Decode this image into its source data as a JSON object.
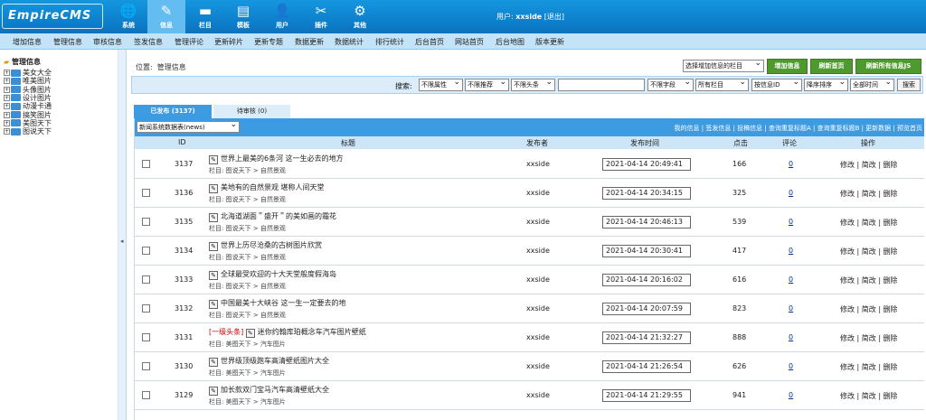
{
  "app": {
    "logo": "EmpireCMS"
  },
  "topnav": [
    {
      "label": "系统",
      "icon": "globe-icon",
      "glyph": "🌐"
    },
    {
      "label": "信息",
      "icon": "edit-icon",
      "glyph": "✎"
    },
    {
      "label": "栏目",
      "icon": "folder-icon",
      "glyph": "▬"
    },
    {
      "label": "模板",
      "icon": "template-icon",
      "glyph": "▤"
    },
    {
      "label": "用户",
      "icon": "user-icon",
      "glyph": "👤"
    },
    {
      "label": "插件",
      "icon": "tools-icon",
      "glyph": "✂"
    },
    {
      "label": "其他",
      "icon": "gear-icon",
      "glyph": "⚙"
    }
  ],
  "user": {
    "prefix": "用户:",
    "name": "xxside",
    "logout": "[退出]"
  },
  "subnav": [
    "增加信息",
    "管理信息",
    "审核信息",
    "签发信息",
    "管理评论",
    "更新碎片",
    "更新专题",
    "数据更新",
    "数据统计",
    "排行统计",
    "后台首页",
    "网站首页",
    "后台地图",
    "版本更新"
  ],
  "sidebar": {
    "title": "管理信息",
    "items": [
      "美女大全",
      "唯美图片",
      "头像图片",
      "设计图片",
      "动漫卡通",
      "搞笑图片",
      "美图天下",
      "图说天下"
    ]
  },
  "position": {
    "label": "位置:",
    "value": "管理信息"
  },
  "top_controls": {
    "column_select": "选择增加信息的栏目",
    "add_info": "增加信息",
    "refresh_home": "刷新首页",
    "refresh_all": "刷新所有信息JS"
  },
  "search": {
    "label": "搜索:",
    "attr": "不限属性",
    "recommend": "不限推荐",
    "headline": "不限头条",
    "keyword": "",
    "field": "不限字段",
    "column": "所有栏目",
    "order_by": "按信息ID",
    "order_dir": "降序排序",
    "time": "全部时间",
    "button": "搜索"
  },
  "tabs": {
    "published": "已发布 (3137)",
    "pending": "待审核 (0)"
  },
  "table": {
    "table_select": "新闻系统数据表(news)",
    "links": "我的信息 | 签发信息 | 投稿信息 | 查询重复标题A | 查询重复标题B | 更新数据 | 预览首页",
    "headers": {
      "id": "ID",
      "title": "标题",
      "publisher": "发布者",
      "time": "发布时间",
      "hits": "点击",
      "comments": "评论",
      "ops": "操作"
    },
    "op_labels": {
      "edit": "修改",
      "simple": "简改",
      "delete": "删除"
    },
    "rows": [
      {
        "id": "3137",
        "tag": "",
        "title": "世界上最美的6条河 这一生必去的地方",
        "cat": "栏目: 图说天下 > 自然景观",
        "publisher": "xxside",
        "time": "2021-04-14 20:49:41",
        "hits": "166",
        "comments": "0"
      },
      {
        "id": "3136",
        "tag": "",
        "title": "美地有的自然景观 堪称人间天堂",
        "cat": "栏目: 图说天下 > 自然景观",
        "publisher": "xxside",
        "time": "2021-04-14 20:34:15",
        "hits": "325",
        "comments": "0"
      },
      {
        "id": "3135",
        "tag": "",
        "title": "北海道湖面＂盛开＂的美如画的霜花",
        "cat": "栏目: 图说天下 > 自然景观",
        "publisher": "xxside",
        "time": "2021-04-14 20:46:13",
        "hits": "539",
        "comments": "0"
      },
      {
        "id": "3134",
        "tag": "",
        "title": "世界上历尽沧桑的古树图片欣赏",
        "cat": "栏目: 图说天下 > 自然景观",
        "publisher": "xxside",
        "time": "2021-04-14 20:30:41",
        "hits": "417",
        "comments": "0"
      },
      {
        "id": "3133",
        "tag": "",
        "title": "全球最受欢迎的十大天堂般度假海岛",
        "cat": "栏目: 图说天下 > 自然景观",
        "publisher": "xxside",
        "time": "2021-04-14 20:16:02",
        "hits": "616",
        "comments": "0"
      },
      {
        "id": "3132",
        "tag": "",
        "title": "中国最美十大峡谷 这一生一定要去的地",
        "cat": "栏目: 图说天下 > 自然景观",
        "publisher": "xxside",
        "time": "2021-04-14 20:07:59",
        "hits": "823",
        "comments": "0"
      },
      {
        "id": "3131",
        "tag": "[一级头条]",
        "title": "迷你约翰库珀概念车汽车图片壁纸",
        "cat": "栏目: 美图天下 > 汽车图片",
        "publisher": "xxside",
        "time": "2021-04-14 21:32:27",
        "hits": "888",
        "comments": "0"
      },
      {
        "id": "3130",
        "tag": "",
        "title": "世界级顶级跑车高清壁纸图片大全",
        "cat": "栏目: 美图天下 > 汽车图片",
        "publisher": "xxside",
        "time": "2021-04-14 21:26:54",
        "hits": "626",
        "comments": "0"
      },
      {
        "id": "3129",
        "tag": "",
        "title": "加长款双门宝马汽车高清壁纸大全",
        "cat": "栏目: 美图天下 > 汽车图片",
        "publisher": "xxside",
        "time": "2021-04-14 21:29:55",
        "hits": "941",
        "comments": "0"
      }
    ]
  }
}
